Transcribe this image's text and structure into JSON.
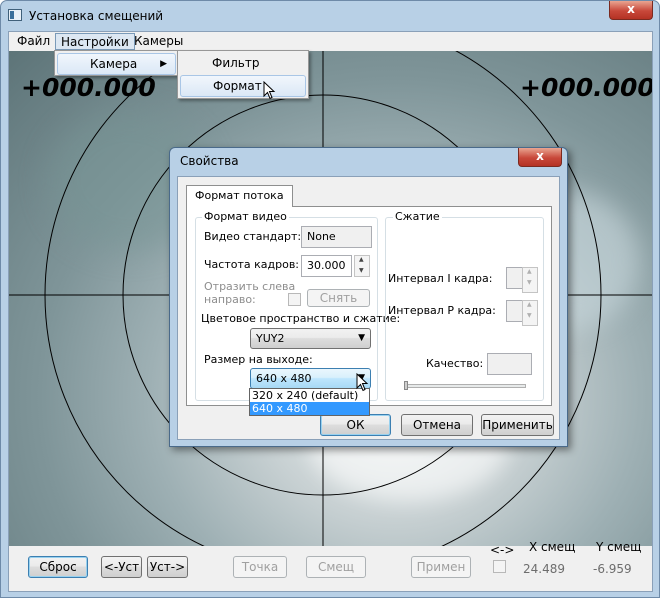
{
  "window": {
    "title": "Установка смещений",
    "close_label": "x"
  },
  "menubar": {
    "file": "Файл",
    "settings": "Настройки",
    "cameras": "Камеры"
  },
  "submenu": {
    "camera": "Камера",
    "camera_arrow": "▶",
    "filter": "Фильтр",
    "format": "Формат"
  },
  "overlay": {
    "left_value": "+000.000",
    "right_value": "+000.000"
  },
  "dialog": {
    "title": "Свойства",
    "close_label": "x",
    "tab": "Формат потока",
    "video_group": {
      "title": "Формат видео",
      "standard_label": "Видео стандарт:",
      "standard_value": "None",
      "fps_label": "Частота кадров:",
      "fps_value": "30.000",
      "mirror_label_line1": "Отразить слева",
      "mirror_label_line2": "направо:",
      "remove_button": "Снять",
      "colorspace_label": "Цветовое пространство и сжатие:",
      "colorspace_value": "YUY2",
      "output_size_label": "Размер на выходе:",
      "output_size_value": "640 x 480",
      "output_size_options": [
        "320 x 240  (default)",
        "640 x 480"
      ],
      "output_size_selected_index": 1
    },
    "compression_group": {
      "title": "Сжатие",
      "i_frame_label": "Интервал I кадра:",
      "p_frame_label": "Интервал P кадра:",
      "quality_label": "Качество:"
    },
    "buttons": {
      "ok": "ОК",
      "cancel": "Отмена",
      "apply": "Применить"
    }
  },
  "bottom_bar": {
    "reset": "Сброс",
    "prev_set": "<-Уст",
    "next_set": "Уст->",
    "point": "Точка",
    "offset": "Смещ",
    "apply": "Примен",
    "swap_label": "<->",
    "x_offset_label": "X смещ",
    "y_offset_label": "Y смещ",
    "x_offset_value": "24.489",
    "y_offset_value": "-6.959"
  }
}
